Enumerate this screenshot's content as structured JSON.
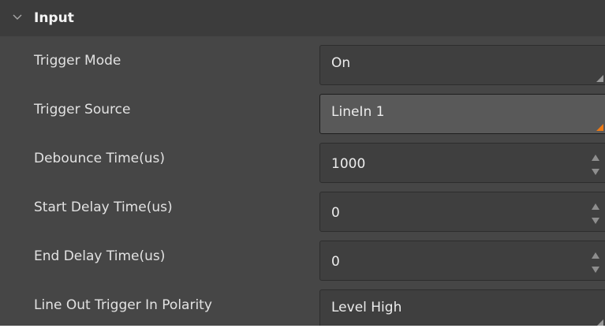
{
  "section": {
    "title": "Input",
    "expanded": true,
    "icon": "chevron-down-icon"
  },
  "colors": {
    "panel_bg": "#464646",
    "header_bg": "#3c3c3c",
    "field_bg": "#3f3f3f",
    "active_field_bg": "#595959",
    "accent": "#ef7a14"
  },
  "parameters": [
    {
      "label": "Trigger Mode",
      "value": "On",
      "control": "dropdown",
      "icon": "dropdown-corner-icon"
    },
    {
      "label": "Trigger Source",
      "value": "LineIn 1",
      "control": "dropdown",
      "icon": "dropdown-corner-icon",
      "active": true
    },
    {
      "label": "Debounce Time(us)",
      "value": "1000",
      "control": "spinbox",
      "icon": "spin-arrows-icon"
    },
    {
      "label": "Start Delay Time(us)",
      "value": "0",
      "control": "spinbox",
      "icon": "spin-arrows-icon"
    },
    {
      "label": "End Delay Time(us)",
      "value": "0",
      "control": "spinbox",
      "icon": "spin-arrows-icon"
    },
    {
      "label": "Line Out Trigger In Polarity",
      "value": "Level High",
      "control": "dropdown",
      "icon": "dropdown-corner-icon"
    }
  ]
}
